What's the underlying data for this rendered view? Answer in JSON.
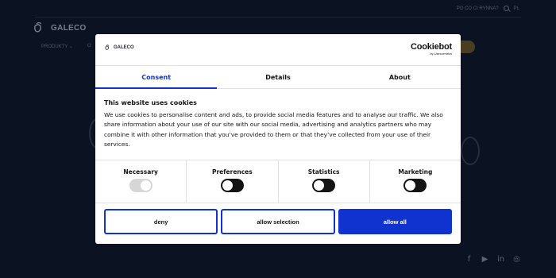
{
  "site": {
    "top_links": [
      "PO CO CI RYNNA?",
      "PL"
    ],
    "logo_text": "GALECO",
    "nav_items": [
      "PRODUKTY ⌄",
      "O"
    ],
    "social_icons": [
      "facebook-icon",
      "youtube-icon",
      "linkedin-icon",
      "instagram-icon"
    ],
    "social_glyphs": [
      "f",
      "▶",
      "in",
      "◎"
    ]
  },
  "dialog": {
    "logo_text": "GALECO",
    "brand": "Cookiebot",
    "brand_sub": "by Usercentrics",
    "tabs": [
      "Consent",
      "Details",
      "About"
    ],
    "active_tab": "Consent",
    "heading": "This website uses cookies",
    "body": "We use cookies to personalise content and ads, to provide social media features and to analyse our traffic. We also share information about your use of our site with our social media, advertising and analytics partners who may combine it with other information that you’ve provided to them or that they’ve collected from your use of their services.",
    "categories": [
      {
        "label": "Necessary",
        "state": "on-disabled"
      },
      {
        "label": "Preferences",
        "state": "off"
      },
      {
        "label": "Statistics",
        "state": "off"
      },
      {
        "label": "Marketing",
        "state": "off"
      }
    ],
    "buttons": {
      "deny": "deny",
      "allow_selection": "allow selection",
      "allow_all": "allow all"
    }
  },
  "colors": {
    "page_bg": "#0b1222",
    "accent": "#1032cf",
    "toggle_off": "#141414",
    "toggle_disabled": "#d6d6d6"
  }
}
